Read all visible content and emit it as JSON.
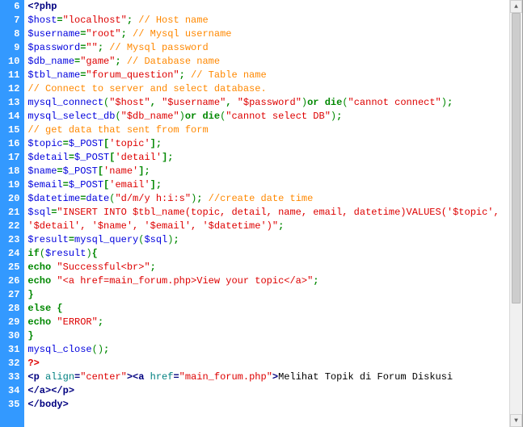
{
  "lines": [
    {
      "num": 6,
      "tokens": [
        [
          "tag",
          "<?php"
        ]
      ]
    },
    {
      "num": 7,
      "tokens": [
        [
          "var",
          "$host"
        ],
        [
          "op",
          "="
        ],
        [
          "str",
          "\"localhost\""
        ],
        [
          "semi",
          ";"
        ],
        [
          "text",
          " "
        ],
        [
          "cmt",
          "// Host name"
        ]
      ]
    },
    {
      "num": 8,
      "tokens": [
        [
          "var",
          "$username"
        ],
        [
          "op",
          "="
        ],
        [
          "str",
          "\"root\""
        ],
        [
          "semi",
          ";"
        ],
        [
          "text",
          " "
        ],
        [
          "cmt",
          "// Mysql username"
        ]
      ]
    },
    {
      "num": 9,
      "tokens": [
        [
          "var",
          "$password"
        ],
        [
          "op",
          "="
        ],
        [
          "str",
          "\"\""
        ],
        [
          "semi",
          ";"
        ],
        [
          "text",
          " "
        ],
        [
          "cmt",
          "// Mysql password"
        ]
      ]
    },
    {
      "num": 10,
      "tokens": [
        [
          "var",
          "$db_name"
        ],
        [
          "op",
          "="
        ],
        [
          "str",
          "\"game\""
        ],
        [
          "semi",
          ";"
        ],
        [
          "text",
          " "
        ],
        [
          "cmt",
          "// Database name"
        ]
      ]
    },
    {
      "num": 11,
      "tokens": [
        [
          "var",
          "$tbl_name"
        ],
        [
          "op",
          "="
        ],
        [
          "str",
          "\"forum_question\""
        ],
        [
          "semi",
          ";"
        ],
        [
          "text",
          " "
        ],
        [
          "cmt",
          "// Table name"
        ]
      ]
    },
    {
      "num": 12,
      "tokens": [
        [
          "cmt",
          "// Connect to server and select database."
        ]
      ]
    },
    {
      "num": 13,
      "tokens": [
        [
          "fn",
          "mysql_connect"
        ],
        [
          "paren",
          "("
        ],
        [
          "str",
          "\"$host\""
        ],
        [
          "op",
          ","
        ],
        [
          "text",
          " "
        ],
        [
          "str",
          "\"$username\""
        ],
        [
          "op",
          ","
        ],
        [
          "text",
          " "
        ],
        [
          "str",
          "\"$password\""
        ],
        [
          "paren",
          ")"
        ],
        [
          "kw",
          "or"
        ],
        [
          "text",
          " "
        ],
        [
          "kw",
          "die"
        ],
        [
          "paren",
          "("
        ],
        [
          "str",
          "\"cannot connect\""
        ],
        [
          "paren",
          ")"
        ],
        [
          "semi",
          ";"
        ]
      ]
    },
    {
      "num": 14,
      "tokens": [
        [
          "fn",
          "mysql_select_db"
        ],
        [
          "paren",
          "("
        ],
        [
          "str",
          "\"$db_name\""
        ],
        [
          "paren",
          ")"
        ],
        [
          "kw",
          "or"
        ],
        [
          "text",
          " "
        ],
        [
          "kw",
          "die"
        ],
        [
          "paren",
          "("
        ],
        [
          "str",
          "\"cannot select DB\""
        ],
        [
          "paren",
          ")"
        ],
        [
          "semi",
          ";"
        ]
      ]
    },
    {
      "num": 15,
      "tokens": [
        [
          "cmt",
          "// get data that sent from form"
        ]
      ]
    },
    {
      "num": 16,
      "tokens": [
        [
          "var",
          "$topic"
        ],
        [
          "op",
          "="
        ],
        [
          "var",
          "$_POST"
        ],
        [
          "brack",
          "["
        ],
        [
          "str",
          "'topic'"
        ],
        [
          "brack",
          "]"
        ],
        [
          "semi",
          ";"
        ]
      ]
    },
    {
      "num": 17,
      "tokens": [
        [
          "var",
          "$detail"
        ],
        [
          "op",
          "="
        ],
        [
          "var",
          "$_POST"
        ],
        [
          "brack",
          "["
        ],
        [
          "str",
          "'detail'"
        ],
        [
          "brack",
          "]"
        ],
        [
          "semi",
          ";"
        ]
      ]
    },
    {
      "num": 18,
      "tokens": [
        [
          "var",
          "$name"
        ],
        [
          "op",
          "="
        ],
        [
          "var",
          "$_POST"
        ],
        [
          "brack",
          "["
        ],
        [
          "str",
          "'name'"
        ],
        [
          "brack",
          "]"
        ],
        [
          "semi",
          ";"
        ]
      ]
    },
    {
      "num": 19,
      "tokens": [
        [
          "var",
          "$email"
        ],
        [
          "op",
          "="
        ],
        [
          "var",
          "$_POST"
        ],
        [
          "brack",
          "["
        ],
        [
          "str",
          "'email'"
        ],
        [
          "brack",
          "]"
        ],
        [
          "semi",
          ";"
        ]
      ]
    },
    {
      "num": 20,
      "tokens": [
        [
          "var",
          "$datetime"
        ],
        [
          "op",
          "="
        ],
        [
          "fn",
          "date"
        ],
        [
          "paren",
          "("
        ],
        [
          "str",
          "\"d/m/y h:i:s\""
        ],
        [
          "paren",
          ")"
        ],
        [
          "semi",
          ";"
        ],
        [
          "text",
          " "
        ],
        [
          "cmt",
          "//create date time"
        ]
      ]
    },
    {
      "num": 21,
      "tokens": [
        [
          "var",
          "$sql"
        ],
        [
          "op",
          "="
        ],
        [
          "str",
          "\"INSERT INTO $tbl_name(topic, detail, name, email, datetime)VALUES('$topic',"
        ]
      ]
    },
    {
      "num": 22,
      "tokens": [
        [
          "str",
          "'$detail', '$name', '$email', '$datetime')\""
        ],
        [
          "semi",
          ";"
        ]
      ]
    },
    {
      "num": 23,
      "tokens": [
        [
          "var",
          "$result"
        ],
        [
          "op",
          "="
        ],
        [
          "fn",
          "mysql_query"
        ],
        [
          "paren",
          "("
        ],
        [
          "var",
          "$sql"
        ],
        [
          "paren",
          ")"
        ],
        [
          "semi",
          ";"
        ]
      ]
    },
    {
      "num": 24,
      "tokens": [
        [
          "kw",
          "if"
        ],
        [
          "paren",
          "("
        ],
        [
          "var",
          "$result"
        ],
        [
          "paren",
          ")"
        ],
        [
          "brace",
          "{"
        ]
      ]
    },
    {
      "num": 25,
      "tokens": [
        [
          "kw",
          "echo"
        ],
        [
          "text",
          " "
        ],
        [
          "str",
          "\"Successful<br>\""
        ],
        [
          "semi",
          ";"
        ]
      ]
    },
    {
      "num": 26,
      "tokens": [
        [
          "kw",
          "echo"
        ],
        [
          "text",
          " "
        ],
        [
          "str",
          "\"<a href=main_forum.php>View your topic</a>\""
        ],
        [
          "semi",
          ";"
        ]
      ]
    },
    {
      "num": 27,
      "tokens": [
        [
          "brace",
          "}"
        ]
      ]
    },
    {
      "num": 28,
      "tokens": [
        [
          "kw",
          "else"
        ],
        [
          "text",
          " "
        ],
        [
          "brace",
          "{"
        ]
      ]
    },
    {
      "num": 29,
      "tokens": [
        [
          "kw",
          "echo"
        ],
        [
          "text",
          " "
        ],
        [
          "str",
          "\"ERROR\""
        ],
        [
          "semi",
          ";"
        ]
      ]
    },
    {
      "num": 30,
      "tokens": [
        [
          "brace",
          "}"
        ]
      ]
    },
    {
      "num": 31,
      "tokens": [
        [
          "fn",
          "mysql_close"
        ],
        [
          "paren",
          "()"
        ],
        [
          "semi",
          ";"
        ]
      ]
    },
    {
      "num": 32,
      "tokens": [
        [
          "php",
          "?>"
        ]
      ]
    },
    {
      "num": 33,
      "tokens": [
        [
          "tag",
          "<p "
        ],
        [
          "attr",
          "align"
        ],
        [
          "tag",
          "="
        ],
        [
          "str",
          "\"center\""
        ],
        [
          "tag",
          ">"
        ],
        [
          "tag",
          "<a "
        ],
        [
          "attr",
          "href"
        ],
        [
          "tag",
          "="
        ],
        [
          "str",
          "\"main_forum.php\""
        ],
        [
          "tag",
          ">"
        ],
        [
          "text",
          "Melihat Topik di Forum Diskusi"
        ]
      ]
    },
    {
      "num": 34,
      "tokens": [
        [
          "tag",
          "</a></p>"
        ]
      ]
    },
    {
      "num": 35,
      "tokens": [
        [
          "tag",
          "</body>"
        ]
      ]
    }
  ]
}
